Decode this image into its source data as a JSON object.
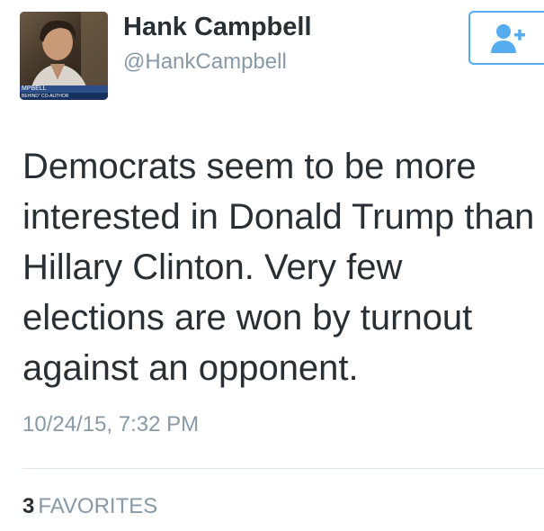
{
  "tweet": {
    "author": {
      "display_name": "Hank Campbell",
      "handle": "@HankCampbell",
      "avatar": {
        "caption_main": "MPBELL",
        "caption_sub": "BEHIND\" CO-AUTHOR"
      }
    },
    "follow_button": {
      "icon": "add-user-icon",
      "color": "#55acee"
    },
    "text": "Democrats seem to be more interested in Donald Trump than Hillary Clinton. Very few elections are won by turnout against an opponent.",
    "timestamp": "10/24/15, 7:32 PM",
    "stats": {
      "favorites_count": "3",
      "favorites_label": "FAVORITES"
    }
  },
  "colors": {
    "text_primary": "#292f33",
    "text_secondary": "#8899a6",
    "accent": "#55acee",
    "divider": "#e1e8ed"
  }
}
